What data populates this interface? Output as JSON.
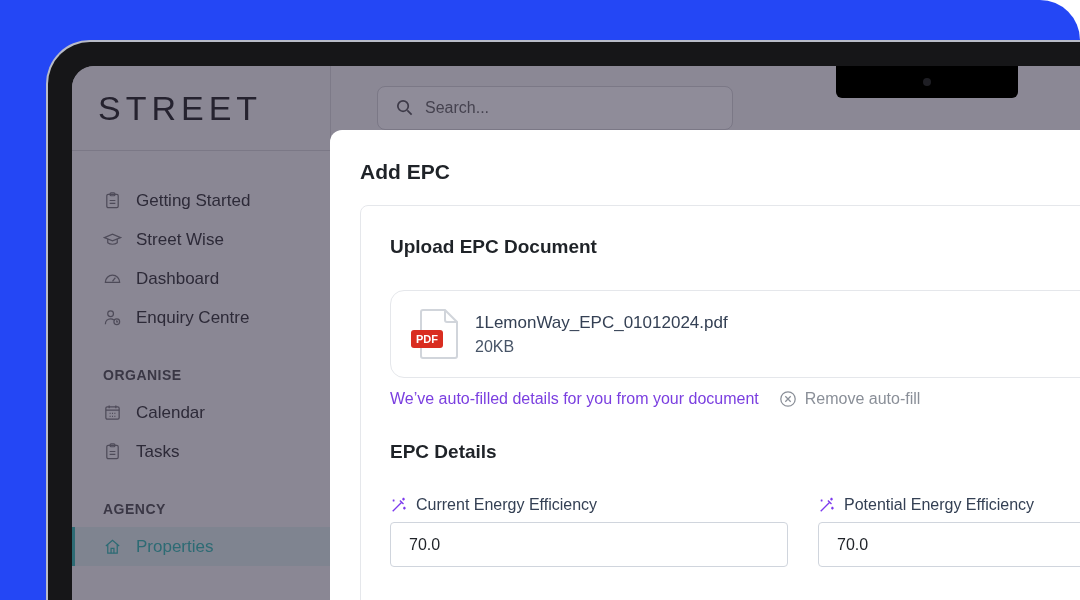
{
  "logo": "STREET",
  "search": {
    "placeholder": "Search..."
  },
  "sidebar": {
    "sections": [
      {
        "items": [
          {
            "label": "Getting Started",
            "selected": false
          },
          {
            "label": "Street Wise",
            "selected": false
          },
          {
            "label": "Dashboard",
            "selected": false
          },
          {
            "label": "Enquiry Centre",
            "selected": false
          }
        ]
      },
      {
        "heading": "ORGANISE",
        "items": [
          {
            "label": "Calendar",
            "selected": false
          },
          {
            "label": "Tasks",
            "selected": false
          }
        ]
      },
      {
        "heading": "AGENCY",
        "items": [
          {
            "label": "Properties",
            "selected": true
          }
        ]
      }
    ]
  },
  "dialog": {
    "title": "Add EPC",
    "upload": {
      "heading": "Upload EPC Document",
      "file": {
        "badge": "PDF",
        "name": "1LemonWay_EPC_01012024.pdf",
        "size": "20KB"
      },
      "notice": "We’ve auto-filled details for you from your document",
      "remove": "Remove auto-fill"
    },
    "details": {
      "heading": "EPC Details",
      "fields": [
        {
          "label": "Current Energy Efficiency",
          "value": "70.0",
          "autofilled": true
        },
        {
          "label": "Potential Energy Efficiency",
          "value": "70.0",
          "autofilled": true
        }
      ]
    }
  }
}
